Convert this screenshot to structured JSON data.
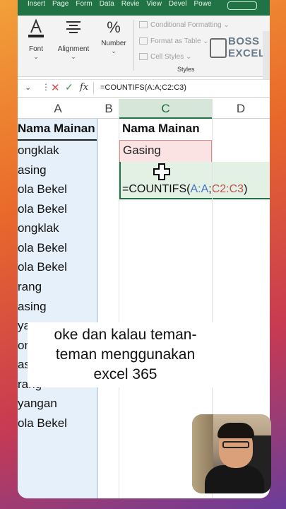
{
  "ribbon": {
    "tabs": [
      "Insert",
      "Page",
      "Form",
      "Data",
      "Revie",
      "View",
      "Devel",
      "Powe"
    ],
    "groups": {
      "font": "Font",
      "alignment": "Alignment",
      "number": "Number"
    },
    "styles": {
      "conditional": "Conditional Formatting",
      "format_table": "Format as Table",
      "cell_styles": "Cell Styles",
      "title": "Styles"
    }
  },
  "logo": {
    "line1": "BOSS",
    "line2": "EXCEL"
  },
  "formula_bar": {
    "fx": "fx",
    "formula": "=COUNTIFS(A:A;C2:C3)"
  },
  "columns": {
    "a": "A",
    "b": "B",
    "c": "C",
    "d": "D"
  },
  "sheet": {
    "col_a_header": "Nama Mainan",
    "col_c_header": "Nama Mainan",
    "col_a_values": [
      "ongklak",
      "asing",
      "ola Bekel",
      "ola Bekel",
      "ongklak",
      "ola Bekel",
      "ola Bekel",
      "rang",
      "asing",
      "yang",
      "ongk",
      "asing",
      "rang",
      "yangan",
      "ola Bekel"
    ],
    "c2_value": "Gasing",
    "cell_formula": {
      "prefix": "=COUNTIFS(",
      "ref1": "A:A",
      "sep": ";",
      "ref2": "C2:C3",
      "suffix": ")"
    }
  },
  "caption": {
    "line1": "oke dan kalau teman-",
    "line2": "teman menggunakan",
    "line3": "excel 365"
  }
}
